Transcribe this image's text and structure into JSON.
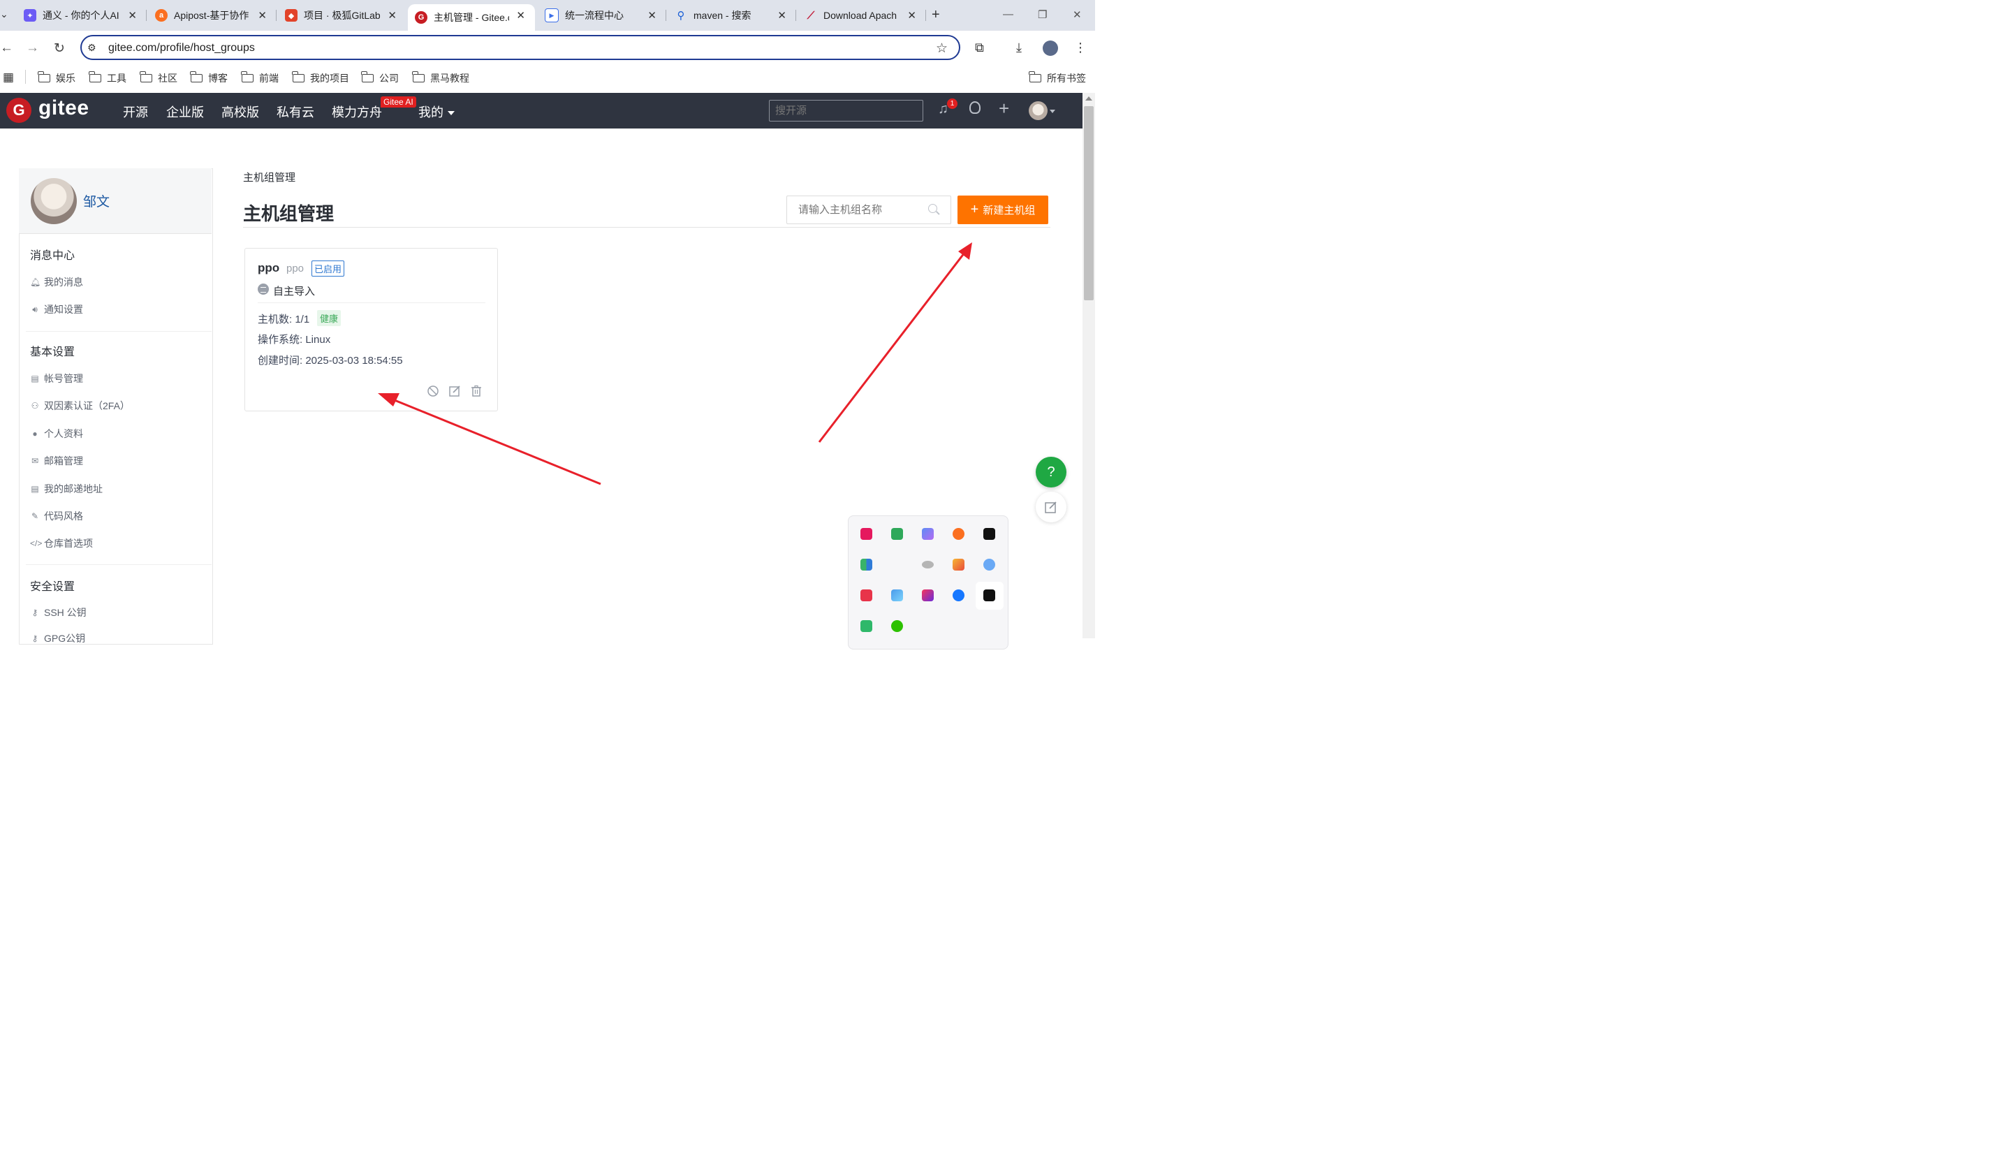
{
  "browser": {
    "tabs": [
      {
        "label": "通义 - 你的个人AI",
        "icon": "tongyi-icon",
        "color": "#6c5cf5"
      },
      {
        "label": "Apipost-基于协作",
        "icon": "apipost-icon",
        "color": "#fb6f20"
      },
      {
        "label": "项目 · 极狐GitLab",
        "icon": "gitlab-icon",
        "color": "#e2432a"
      },
      {
        "label": "主机管理 - Gitee.c",
        "icon": "gitee-icon",
        "color": "#c71d23",
        "active": true
      },
      {
        "label": "统一流程中心",
        "icon": "flow-icon",
        "color": "#3b6ee8"
      },
      {
        "label": "maven - 搜索",
        "icon": "search-icon",
        "color": "#1a5fd6"
      },
      {
        "label": "Download Apach",
        "icon": "feather-icon",
        "color": "#c21d3a"
      }
    ],
    "url": "gitee.com/profile/host_groups",
    "bookmarks": [
      "娱乐",
      "工具",
      "社区",
      "博客",
      "前端",
      "我的项目",
      "公司",
      "黑马教程"
    ],
    "all_bookmarks": "所有书签"
  },
  "header": {
    "logo_text": "gitee",
    "nav": [
      "开源",
      "企业版",
      "高校版",
      "私有云",
      "模力方舟",
      "我的"
    ],
    "ai_badge": "Gitee AI",
    "search_placeholder": "搜开源",
    "notification_count": "1"
  },
  "sidebar": {
    "username": "邹文",
    "sections": [
      {
        "title": "消息中心",
        "items": [
          "我的消息",
          "通知设置"
        ]
      },
      {
        "title": "基本设置",
        "items": [
          "帐号管理",
          "双因素认证（2FA）",
          "个人资料",
          "邮箱管理",
          "我的邮递地址",
          "代码风格",
          "仓库首选项"
        ]
      },
      {
        "title": "安全设置",
        "items": [
          "SSH 公钥",
          "GPG公钥"
        ]
      }
    ]
  },
  "main": {
    "breadcrumb": "主机组管理",
    "title": "主机组管理",
    "search_placeholder": "请输入主机组名称",
    "new_button": "新建主机组",
    "card": {
      "name": "ppo",
      "id": "ppo",
      "status": "已启用",
      "source": "自主导入",
      "host_count": "主机数: 1/1",
      "health": "健康",
      "os": "操作系统: Linux",
      "created": "创建时间: 2025-03-03 18:54:55"
    }
  },
  "colors": {
    "accent": "#fe7300",
    "header_bg": "#2f3440",
    "link": "#1e5aa3",
    "annotation_arrow": "#e8202a"
  }
}
